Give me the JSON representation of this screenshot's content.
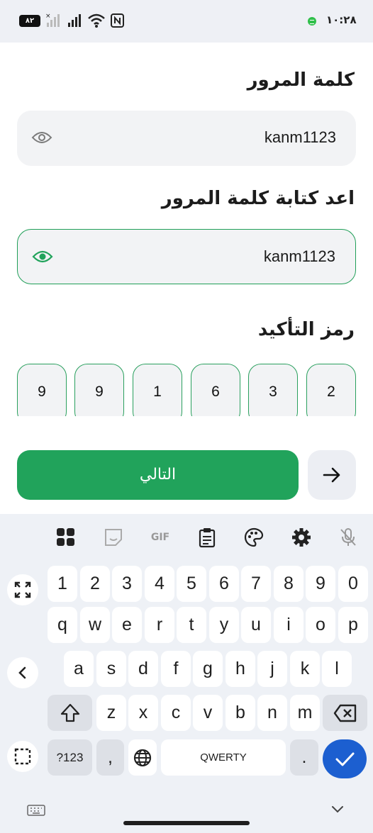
{
  "status_bar": {
    "time": "١٠:٢٨",
    "battery": "٨٢"
  },
  "form": {
    "password_label": "كلمة المرور",
    "password_value": "kanm1123",
    "confirm_label": "اعد كتابة كلمة المرور",
    "confirm_value": "kanm1123",
    "code_label": "رمز التأكيد",
    "code_digits": [
      "2",
      "3",
      "6",
      "1",
      "9",
      "9"
    ]
  },
  "actions": {
    "next_label": "التالي"
  },
  "keyboard": {
    "toolbar": {
      "gif_label": "GIF"
    },
    "row_numbers": [
      "1",
      "2",
      "3",
      "4",
      "5",
      "6",
      "7",
      "8",
      "9",
      "0"
    ],
    "row_top": [
      "q",
      "w",
      "e",
      "r",
      "t",
      "y",
      "u",
      "i",
      "o",
      "p"
    ],
    "row_middle": [
      "a",
      "s",
      "d",
      "f",
      "g",
      "h",
      "j",
      "k",
      "l"
    ],
    "row_bottom": [
      "z",
      "x",
      "c",
      "v",
      "b",
      "n",
      "m"
    ],
    "symbols_label": "?123",
    "comma_label": ",",
    "space_label": "QWERTY",
    "period_label": "."
  },
  "colors": {
    "accent_green": "#21a35b",
    "enter_blue": "#1c5fd0"
  }
}
